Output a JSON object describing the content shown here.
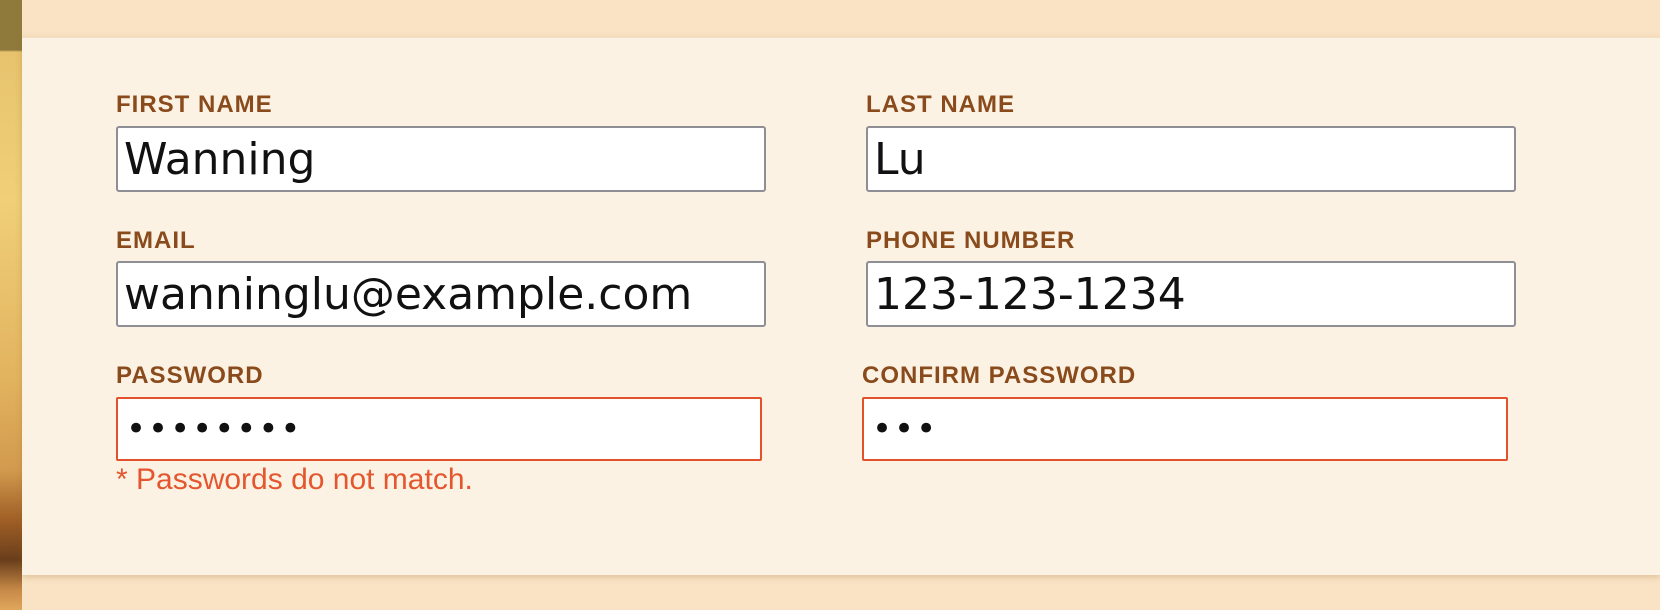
{
  "colors": {
    "label": "#8a4b1c",
    "error": "#e4572e",
    "input_border": "#8e8e95",
    "card_background": "#fcf2e4",
    "page_background": "#f9e3c4"
  },
  "form": {
    "first_name": {
      "label": "FIRST NAME",
      "value": "Wanning"
    },
    "last_name": {
      "label": "LAST NAME",
      "value": "Lu"
    },
    "email": {
      "label": "EMAIL",
      "value": "wanninglu@example.com"
    },
    "phone": {
      "label": "PHONE NUMBER",
      "value": "123-123-1234"
    },
    "password": {
      "label": "PASSWORD",
      "value": "••••••••",
      "error": "* Passwords do not match."
    },
    "confirm_password": {
      "label": "CONFIRM PASSWORD",
      "value": "•••"
    }
  }
}
